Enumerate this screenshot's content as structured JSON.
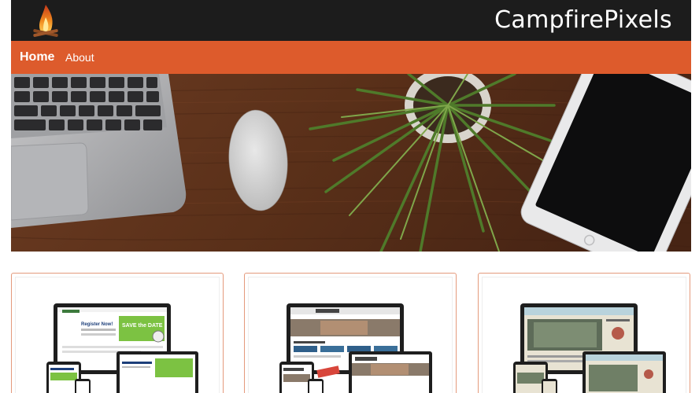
{
  "header": {
    "brand": "CampfirePixels",
    "logo_icon": "campfire-icon"
  },
  "nav": {
    "items": [
      {
        "label": "Home",
        "active": true
      },
      {
        "label": "About",
        "active": false
      }
    ]
  },
  "hero": {
    "image_description_icon": "desk-workspace-image"
  },
  "portfolio": {
    "cards": [
      {
        "screen_headline": "Register Now!",
        "badge": "SAVE the DATE"
      },
      {
        "screen_headline": "",
        "badge": ""
      },
      {
        "screen_headline": "",
        "badge": ""
      }
    ]
  },
  "colors": {
    "header_bg": "#1c1c1c",
    "nav_bg": "#dd5b2c",
    "card_border": "#e49a7c"
  }
}
